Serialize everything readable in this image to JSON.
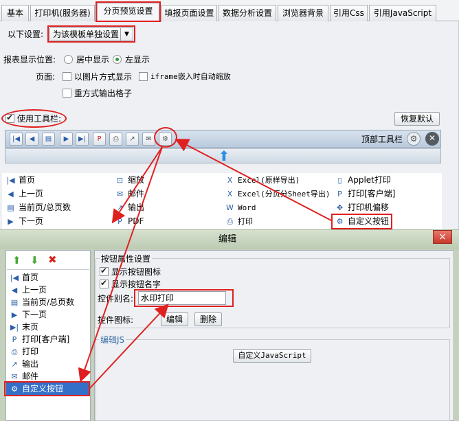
{
  "tabs": [
    "基本",
    "打印机(服务器)",
    "分页预览设置",
    "填报页面设置",
    "数据分析设置",
    "浏览器背景",
    "引用Css",
    "引用JavaScript"
  ],
  "settings": {
    "below_label": "以下设置:",
    "scope_value": "为该模板单独设置",
    "position_label": "报表显示位置:",
    "pos_center": "居中显示",
    "pos_left": "左显示",
    "page_label": "页面:",
    "as_image": "以图片方式显示",
    "iframe_zoom": "iframe嵌入时自动缩放",
    "repeat_grid": "重方式输出格子",
    "use_toolbar": "使用工具栏:",
    "restore_default": "恢复默认",
    "top_toolbar": "顶部工具栏"
  },
  "toolbar_icons": [
    "first-page-icon",
    "prev-page-icon",
    "page-number-icon",
    "next-page-icon",
    "last-page-icon",
    "pdf-icon",
    "printer-icon",
    "export-icon",
    "mail-icon",
    "gear-icon"
  ],
  "buttons_grid": [
    {
      "icon": "first-page-icon",
      "label": "首页"
    },
    {
      "icon": "zoom-icon",
      "label": "缩放"
    },
    {
      "icon": "excel-icon",
      "label": "Excel(原样导出)"
    },
    {
      "icon": "applet-icon",
      "label": "Applet打印"
    },
    {
      "icon": "prev-page-icon",
      "label": "上一页"
    },
    {
      "icon": "mail-icon",
      "label": "邮件"
    },
    {
      "icon": "excel-icon",
      "label": "Excel(分页分Sheet导出)"
    },
    {
      "icon": "pdf-icon",
      "label": "打印[客户端]"
    },
    {
      "icon": "page-number-icon",
      "label": "当前页/总页数"
    },
    {
      "icon": "export-icon",
      "label": "输出"
    },
    {
      "icon": "word-icon",
      "label": "Word"
    },
    {
      "icon": "move-icon",
      "label": "打印机偏移"
    },
    {
      "icon": "next-page-icon",
      "label": "下一页"
    },
    {
      "icon": "pdf-icon",
      "label": "PDF"
    },
    {
      "icon": "printer-icon",
      "label": "打印"
    },
    {
      "icon": "gear-icon",
      "label": "自定义按钮"
    }
  ],
  "dialog": {
    "title": "编辑",
    "close": "×",
    "list": [
      {
        "icon": "first-page-icon",
        "label": "首页"
      },
      {
        "icon": "prev-page-icon",
        "label": "上一页"
      },
      {
        "icon": "page-number-icon",
        "label": "当前页/总页数"
      },
      {
        "icon": "next-page-icon",
        "label": "下一页"
      },
      {
        "icon": "last-page-icon",
        "label": "末页"
      },
      {
        "icon": "pdf-icon",
        "label": "打印[客户端]"
      },
      {
        "icon": "printer-icon",
        "label": "打印"
      },
      {
        "icon": "export-icon",
        "label": "输出"
      },
      {
        "icon": "mail-icon",
        "label": "邮件"
      },
      {
        "icon": "gear-icon",
        "label": "自定义按钮"
      }
    ],
    "props_title": "按钮属性设置",
    "show_icon": "显示按钮图标",
    "show_name": "显示按钮名字",
    "alias_label": "控件别名:",
    "alias_value": "水印打印",
    "icon_label": "控件图标:",
    "edit_btn": "编辑",
    "delete_btn": "删除",
    "js_title": "编辑JS",
    "custom_js_btn": "自定义JavaScript"
  },
  "colors": {
    "accent": "#e02020",
    "selection": "#3470c8",
    "dialog_bg": "#c5d1bc"
  }
}
